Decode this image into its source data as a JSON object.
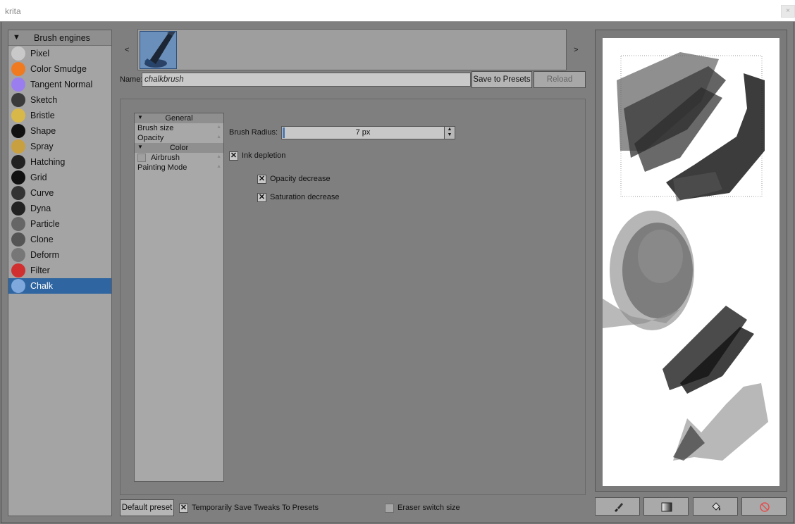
{
  "window": {
    "title": "krita",
    "close_label": "×"
  },
  "engines": {
    "header": "Brush engines",
    "items": [
      {
        "label": "Pixel",
        "icon": "pixel-brush-icon",
        "color": "#c9c9c9"
      },
      {
        "label": "Color Smudge",
        "icon": "color-smudge-icon",
        "color": "#f07a1f"
      },
      {
        "label": "Tangent Normal",
        "icon": "tangent-normal-icon",
        "color": "#9a7ef0"
      },
      {
        "label": "Sketch",
        "icon": "sketch-icon",
        "color": "#3a3a3a"
      },
      {
        "label": "Bristle",
        "icon": "bristle-icon",
        "color": "#d9b84a"
      },
      {
        "label": "Shape",
        "icon": "shape-icon",
        "color": "#111111"
      },
      {
        "label": "Spray",
        "icon": "spray-icon",
        "color": "#c8a040"
      },
      {
        "label": "Hatching",
        "icon": "hatching-icon",
        "color": "#222222"
      },
      {
        "label": "Grid",
        "icon": "grid-icon",
        "color": "#111111"
      },
      {
        "label": "Curve",
        "icon": "curve-icon",
        "color": "#333333"
      },
      {
        "label": "Dyna",
        "icon": "dyna-icon",
        "color": "#222222"
      },
      {
        "label": "Particle",
        "icon": "particle-icon",
        "color": "#666666"
      },
      {
        "label": "Clone",
        "icon": "clone-icon",
        "color": "#555555"
      },
      {
        "label": "Deform",
        "icon": "deform-icon",
        "color": "#777777"
      },
      {
        "label": "Filter",
        "icon": "filter-icon",
        "color": "#d03030"
      },
      {
        "label": "Chalk",
        "icon": "chalk-icon",
        "color": "#7fa9dc",
        "selected": true
      }
    ]
  },
  "presets": {
    "prev": "<",
    "next": ">",
    "thumb_icon": "chalk-preset-thumbnail"
  },
  "name_field": {
    "label": "Name:",
    "value": "chalkbrush"
  },
  "buttons": {
    "save": "Save to Presets",
    "reload": "Reload",
    "default_preset": "Default preset"
  },
  "options": {
    "general_header": "General",
    "brush_size": "Brush size",
    "opacity": "Opacity",
    "color_header": "Color",
    "airbrush": "Airbrush",
    "painting_mode": "Painting Mode",
    "indicator": "▲"
  },
  "settings": {
    "brush_radius_label": "Brush Radius:",
    "brush_radius_value": "7 px",
    "ink_depletion": "Ink depletion",
    "opacity_decrease": "Opacity decrease",
    "saturation_decrease": "Saturation decrease"
  },
  "footer": {
    "save_tweaks": "Temporarily Save Tweaks To Presets",
    "eraser_switch": "Eraser switch size"
  },
  "scratchpad_buttons": [
    "brush-fill-icon",
    "gradient-icon",
    "paint-bucket-icon",
    "clear-icon"
  ]
}
